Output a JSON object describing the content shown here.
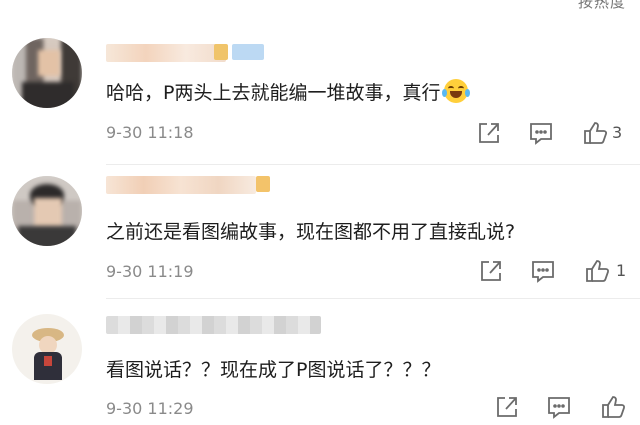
{
  "header": {
    "sort_label": "按热度"
  },
  "comments": [
    {
      "text": "哈哈，P两头上去就能编一堆故事，真行",
      "emoji": "laughing-tears",
      "time": "9-30 11:18",
      "likes": "3"
    },
    {
      "text": "之前还是看图编故事，现在图都不用了直接乱说?",
      "time": "9-30 11:19",
      "likes": "1"
    },
    {
      "text": "看图说话？？现在成了P图说话了？？？",
      "time": "9-30 11:29",
      "likes": ""
    }
  ],
  "icons": {
    "share": "share-icon",
    "comment": "comment-icon",
    "like": "thumbs-up-icon"
  },
  "colors": {
    "icon": "#6b6b6b",
    "time": "#8a8a8a",
    "text": "#1e1e1e",
    "emoji": "#ffcf3b"
  }
}
